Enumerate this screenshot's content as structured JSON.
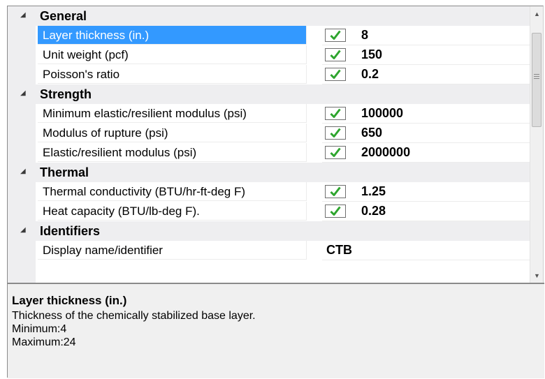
{
  "categories": [
    {
      "title": "General",
      "properties": [
        {
          "name": "Layer thickness (in.)",
          "value": "8",
          "checked": true,
          "selected": true
        },
        {
          "name": "Unit weight (pcf)",
          "value": "150",
          "checked": true
        },
        {
          "name": "Poisson's ratio",
          "value": "0.2",
          "checked": true
        }
      ]
    },
    {
      "title": "Strength",
      "properties": [
        {
          "name": "Minimum elastic/resilient modulus (psi)",
          "value": "100000",
          "checked": true
        },
        {
          "name": "Modulus of rupture (psi)",
          "value": "650",
          "checked": true
        },
        {
          "name": "Elastic/resilient modulus (psi)",
          "value": "2000000",
          "checked": true
        }
      ]
    },
    {
      "title": "Thermal",
      "properties": [
        {
          "name": "Thermal conductivity (BTU/hr-ft-deg F)",
          "value": "1.25",
          "checked": true
        },
        {
          "name": "Heat capacity (BTU/lb-deg F).",
          "value": "0.28",
          "checked": true
        }
      ]
    },
    {
      "title": "Identifiers",
      "properties": [
        {
          "name": "Display name/identifier",
          "value": "CTB",
          "checked": false
        }
      ]
    }
  ],
  "description": {
    "title": "Layer thickness (in.)",
    "text": "Thickness of the chemically stabilized base layer.",
    "minimum": "Minimum:4",
    "maximum": "Maximum:24"
  },
  "icons": {
    "expander": "collapse-triangle-icon",
    "checkbox": "checkmark-icon",
    "checkmark_color": "#2ea52e",
    "selection_color": "#3399ff"
  }
}
